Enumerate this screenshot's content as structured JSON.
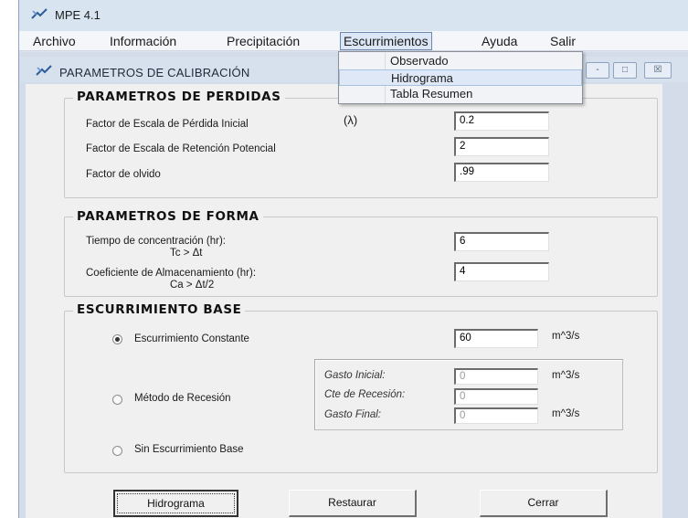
{
  "app": {
    "title": "MPE 4.1"
  },
  "menubar": {
    "items": [
      "Archivo",
      "Información",
      "Precipitación",
      "Escurrimientos",
      "Ayuda",
      "Salir"
    ],
    "active_index": 3
  },
  "dropdown": {
    "items": [
      "Observado",
      "Hidrograma",
      "Tabla Resumen"
    ],
    "hover_index": 1
  },
  "dialog": {
    "title": "PARAMETROS DE CALIBRACIÓN"
  },
  "perdidas": {
    "title": "PARAMETROS DE PERDIDAS",
    "rows": [
      {
        "label": "Factor de Escala de Pérdida Inicial",
        "symbol": "(λ)",
        "value": "0.2"
      },
      {
        "label": "Factor de Escala de Retención Potencial",
        "value": "2"
      },
      {
        "label": "Factor de olvido",
        "value": ".99"
      }
    ]
  },
  "forma": {
    "title": "PARAMETROS DE FORMA",
    "rows": [
      {
        "label": "Tiempo de concentración (hr):",
        "sublabel": "Tc > Δt",
        "value": "6"
      },
      {
        "label": "Coeficiente de Almacenamiento (hr):",
        "sublabel": "Ca > Δt/2",
        "value": "4"
      }
    ]
  },
  "base": {
    "title": "ESCURRIMIENTO BASE",
    "constante": {
      "label": "Escurrimiento Constante",
      "value": "60",
      "unit": "m^3/s",
      "checked": true
    },
    "recesion": {
      "label": "Método de Recesión",
      "checked": false,
      "fields": [
        {
          "label": "Gasto Inicial:",
          "value": "0",
          "unit": "m^3/s"
        },
        {
          "label": "Cte de Recesión:",
          "value": "0",
          "unit": ""
        },
        {
          "label": "Gasto Final:",
          "value": "0",
          "unit": "m^3/s"
        }
      ]
    },
    "sin": {
      "label": "Sin Escurrimiento Base",
      "checked": false
    }
  },
  "buttons": {
    "hidrograma": "Hidrograma",
    "restaurar": "Restaurar",
    "cerrar": "Cerrar"
  },
  "window_controls": {
    "minimize": "-",
    "maximize": "□",
    "close": "☒"
  }
}
